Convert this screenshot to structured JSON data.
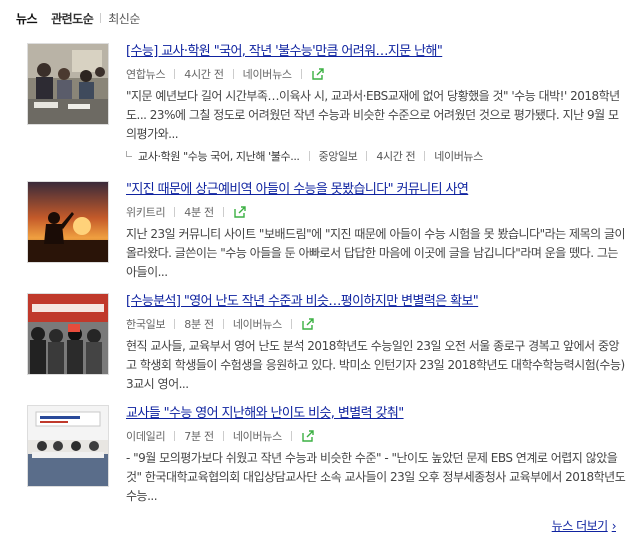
{
  "tabs": [
    {
      "label": "뉴스"
    },
    {
      "label": "관련도순"
    },
    {
      "label": "최신순"
    }
  ],
  "items": [
    {
      "title": "[수능] 교사·학원 \"국어, 작년 '불수능'만큼 어려워…지문 난해\"",
      "source": "연합뉴스",
      "time": "4시간 전",
      "platform": "네이버뉴스",
      "desc": "\"지문 예년보다 길어 시간부족…이육사 시, 교과서·EBS교재에 없어 당황했을 것\" '수능 대박!' 2018학년도... 23%에 그칠 정도로 어려웠던 작년 수능과 비슷한 수준으로 어려웠던 것으로 평가됐다. 지난 9월 모의평가와...",
      "related": {
        "title": "교사·학원 \"수능 국어, 지난해 '불수...",
        "source": "중앙일보",
        "time": "4시간 전",
        "platform": "네이버뉴스"
      }
    },
    {
      "title": "\"지진 때문에 상근예비역 아들이 수능을 못봤습니다\" 커뮤니티 사연",
      "source": "위키트리",
      "time": "4분 전",
      "desc": "지난 23일 커뮤니티 사이트 \"보배드림\"에 \"지진 때문에 아들이 수능 시험을 못 봤습니다\"라는 제목의 글이 올라왔다. 글쓴이는 \"수능 아들을 둔 아빠로서 답답한 마음에 이곳에 글을 남깁니다\"라며 운을 뗐다. 그는 아들이..."
    },
    {
      "title": "[수능분석] \"영어 난도 작년 수준과 비슷…평이하지만 변별력은 확보\"",
      "source": "한국일보",
      "time": "8분 전",
      "platform": "네이버뉴스",
      "desc": "현직 교사들, 교육부서 영어 난도 분석 2018학년도 수능일인 23일 오전 서울 종로구 경복고 앞에서 중앙고 학생회 학생들이 수험생을 응원하고 있다. 박미소 인턴기자 23일 2018학년도 대학수학능력시험(수능) 3교시 영어..."
    },
    {
      "title": "교사들 \"수능 영어 지난해와 난이도 비슷, 변별력 갖춰\"",
      "source": "이데일리",
      "time": "7분 전",
      "platform": "네이버뉴스",
      "desc": "- \"9월 모의평가보다 쉬웠고 작년 수능과 비슷한 수준\" - \"난이도 높았던 문제 EBS 연계로 어렵지 않았을 것\" 한국대학교육협의회 대입상담교사단 소속 교사들이 23일 오후 정부세종청사 교육부에서 2018학년도 수능..."
    }
  ],
  "more_label": "뉴스 더보기",
  "colors": {
    "link": "#0f23a0",
    "share_icon": "#3cb043"
  }
}
